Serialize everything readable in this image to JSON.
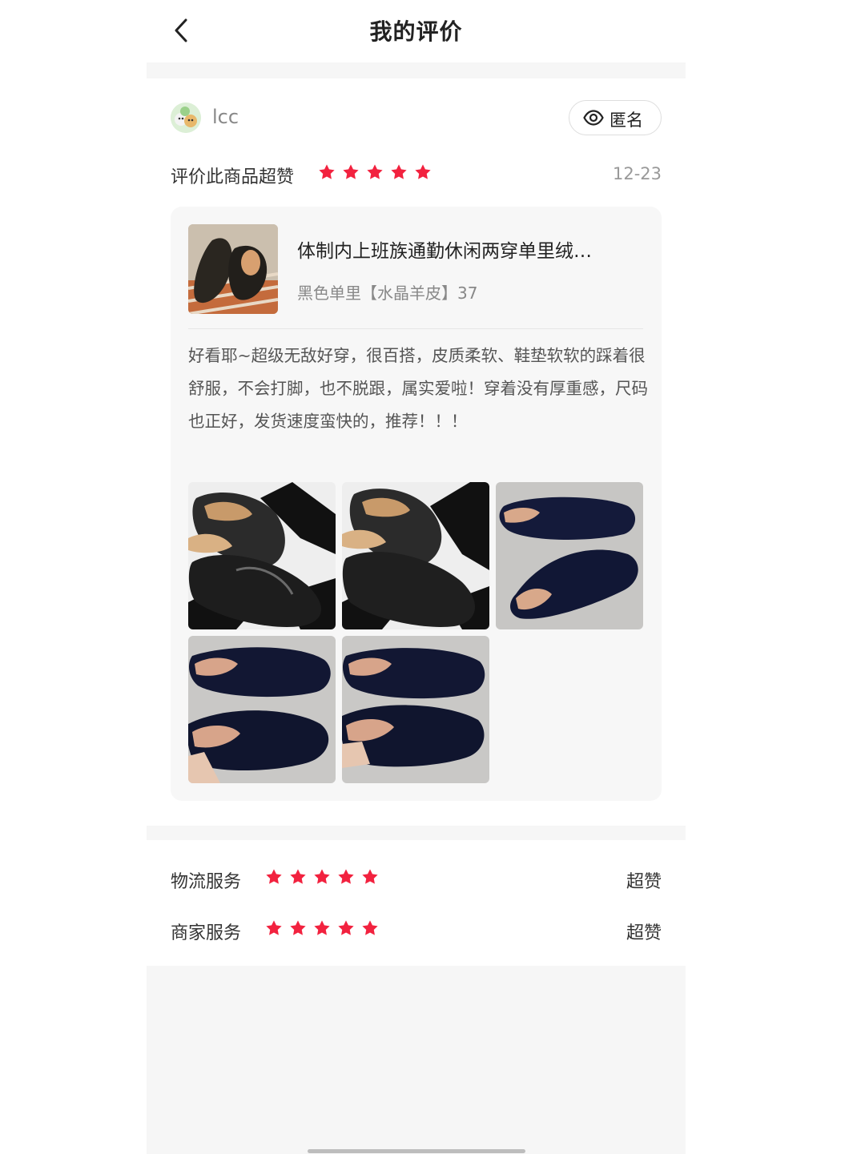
{
  "header": {
    "title": "我的评价"
  },
  "review": {
    "username": "lcc",
    "anonymous_label": "匿名",
    "rating_label": "评价此商品超赞",
    "rating_stars": 5,
    "date": "12-23",
    "product": {
      "title": "体制内上班族通勤休闲两穿单里绒…",
      "spec": "黑色单里【水晶羊皮】37"
    },
    "text": "好看耶~超级无敌好穿，很百搭，皮质柔软、鞋垫软软的踩着很舒服，不会打脚，也不脱跟，属实爱啦！穿着没有厚重感，尺码也正好，发货速度蛮快的，推荐！！！",
    "photo_count": 5
  },
  "services": [
    {
      "label": "物流服务",
      "stars": 5,
      "value": "超赞"
    },
    {
      "label": "商家服务",
      "stars": 5,
      "value": "超赞"
    }
  ],
  "colors": {
    "star": "#f2223f",
    "separator": "#f6f6f6",
    "card_bg": "#f7f7f7"
  }
}
